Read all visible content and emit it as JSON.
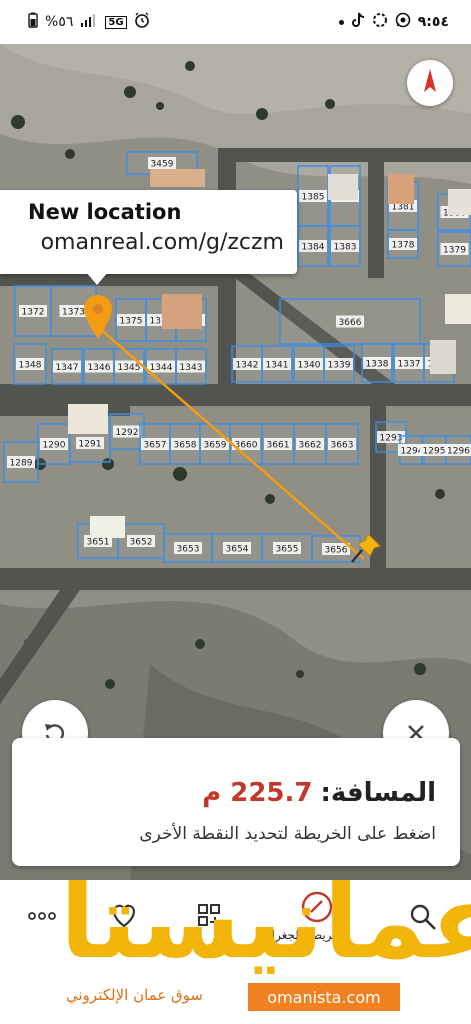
{
  "status_bar": {
    "time": "٩:٥٤",
    "battery": "%٥٦",
    "network": "5G"
  },
  "map": {
    "parcels": [
      {
        "id": "3459"
      },
      {
        "id": "1385"
      },
      {
        "id": "1382"
      },
      {
        "id": "1381"
      },
      {
        "id": "1380"
      },
      {
        "id": "1384"
      },
      {
        "id": "1383"
      },
      {
        "id": "1378"
      },
      {
        "id": "1379"
      },
      {
        "id": "1372"
      },
      {
        "id": "1373"
      },
      {
        "id": "1375"
      },
      {
        "id": "1376"
      },
      {
        "id": "1377"
      },
      {
        "id": "3666"
      },
      {
        "id": "1348"
      },
      {
        "id": "1347"
      },
      {
        "id": "1346"
      },
      {
        "id": "1345"
      },
      {
        "id": "1344"
      },
      {
        "id": "1343"
      },
      {
        "id": "1342"
      },
      {
        "id": "1341"
      },
      {
        "id": "1340"
      },
      {
        "id": "1339"
      },
      {
        "id": "1338"
      },
      {
        "id": "1337"
      },
      {
        "id": "1336"
      },
      {
        "id": "1290"
      },
      {
        "id": "1291"
      },
      {
        "id": "1292"
      },
      {
        "id": "1289"
      },
      {
        "id": "3657"
      },
      {
        "id": "3658"
      },
      {
        "id": "3659"
      },
      {
        "id": "3660"
      },
      {
        "id": "3661"
      },
      {
        "id": "3662"
      },
      {
        "id": "3663"
      },
      {
        "id": "1293"
      },
      {
        "id": "1294"
      },
      {
        "id": "1295"
      },
      {
        "id": "1296"
      },
      {
        "id": "3651"
      },
      {
        "id": "3652"
      },
      {
        "id": "3653"
      },
      {
        "id": "3654"
      },
      {
        "id": "3655"
      },
      {
        "id": "3656"
      }
    ]
  },
  "tooltip": {
    "title": "New location",
    "url": "omanreal.com/g/zczm"
  },
  "distance_card": {
    "label": "المسافة:",
    "value": "225.7 م",
    "hint": "اضغط على الخريطة لتحديد النقطة الأخرى"
  },
  "bottom_bar": {
    "satellite_label": "الخريطة الجغرافية"
  },
  "watermark": {
    "logo_text": "عمانيستا",
    "subtitle": "سوق عمان الإلكتروني",
    "site": "omanista.com"
  },
  "colors": {
    "accent_orange": "#f39c12",
    "distance_red": "#c0392b",
    "logo_yellow": "#f2b50a",
    "parcel_blue": "#3a8ee6"
  }
}
